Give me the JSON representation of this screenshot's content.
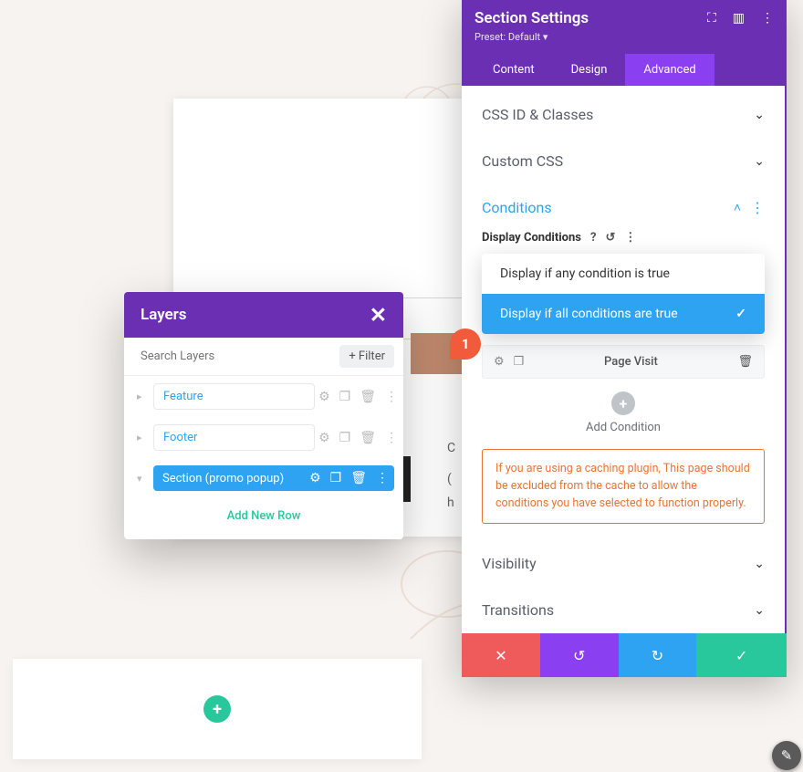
{
  "layers": {
    "title": "Layers",
    "search_placeholder": "Search Layers",
    "filter_label": "+ Filter",
    "items": [
      {
        "label": "Feature",
        "selected": false
      },
      {
        "label": "Footer",
        "selected": false
      },
      {
        "label": "Section (promo popup)",
        "selected": true
      }
    ],
    "add_row": "Add New Row"
  },
  "settings": {
    "title": "Section Settings",
    "preset_label": "Preset: Default",
    "tabs": [
      {
        "label": "Content",
        "active": false
      },
      {
        "label": "Design",
        "active": false
      },
      {
        "label": "Advanced",
        "active": true
      }
    ],
    "sections": {
      "css_id": "CSS ID & Classes",
      "custom_css": "Custom CSS",
      "conditions": "Conditions",
      "visibility": "Visibility",
      "transitions": "Transitions"
    },
    "display_conditions_label": "Display Conditions",
    "dropdown": {
      "any": "Display if any condition is true",
      "all": "Display if all conditions are true"
    },
    "condition_row": "Page Visit",
    "add_condition": "Add Condition",
    "warning": "If you are using a caching plugin, This page should be excluded from the cache to allow the conditions you have selected to function properly."
  },
  "annotation": {
    "badge1": "1"
  },
  "snippets": {
    "a": "C",
    "b": "(",
    "c": "h"
  },
  "icons": {
    "close": "✕",
    "gear": "✿",
    "copy": "❐",
    "trash": "🗑",
    "dots": "⋮",
    "help": "?",
    "undo": "↺",
    "redo": "↻",
    "check": "✓",
    "plus": "+",
    "chev_down": "⌄",
    "chev_up": "˄",
    "expand": "⛶",
    "panel": "▥",
    "tri": "▸",
    "tri_down": "▾"
  }
}
